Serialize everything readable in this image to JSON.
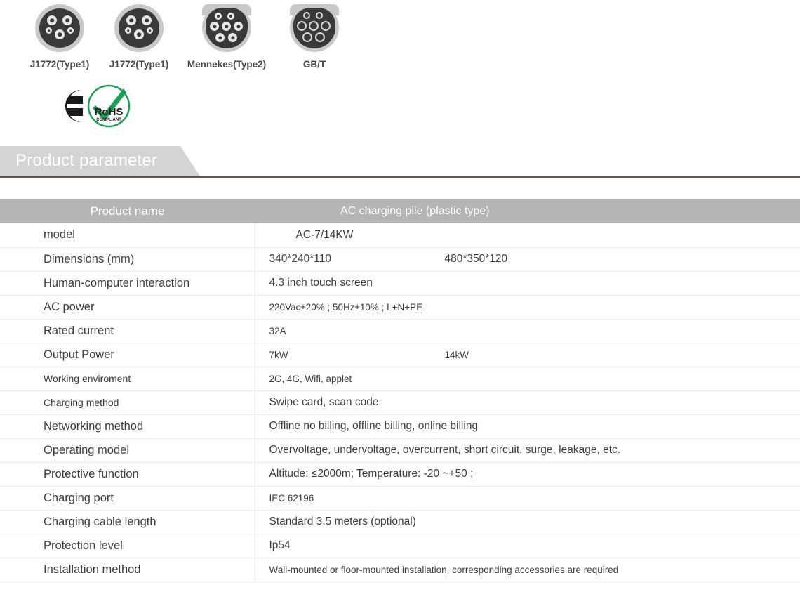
{
  "connectors": [
    {
      "label": "J1772(Type1)",
      "icon": "j1772-type1-connector-icon",
      "shape": "round"
    },
    {
      "label": "J1772(Type1)",
      "icon": "j1772-type1-connector-icon",
      "shape": "round"
    },
    {
      "label": "Mennekes(Type2)",
      "icon": "mennekes-type2-connector-icon",
      "shape": "flat"
    },
    {
      "label": "GB/T",
      "icon": "gbt-connector-icon",
      "shape": "flat"
    }
  ],
  "certifications": [
    {
      "name": "ce-mark-icon",
      "label": "CE"
    },
    {
      "name": "rohs-compliant-icon",
      "label": "RoHS",
      "sublabel": "COMPLIANT"
    }
  ],
  "section": {
    "title": "Product parameter",
    "banner_color": "#d5d3d3",
    "rule_color": "#6d4e4e"
  },
  "table": {
    "header": {
      "name": "Product name",
      "value": "AC charging pile (plastic type)",
      "background": "#b5b5b5",
      "text_color": "#ffffff"
    },
    "rows": [
      {
        "name": "model",
        "value": "AC-7/14KW",
        "name_size": "normal",
        "value_size": "normal",
        "indent": true
      },
      {
        "name": "Dimensions (mm)",
        "value": "340*240*110",
        "value2": "480*350*120",
        "name_size": "normal",
        "value_size": "normal"
      },
      {
        "name": "Human-computer interaction",
        "value": "4.3 inch touch screen",
        "name_size": "normal",
        "value_size": "normal"
      },
      {
        "name": "AC power",
        "value": "220Vac±20% ; 50Hz±10% ; L+N+PE",
        "name_size": "normal",
        "value_size": "small"
      },
      {
        "name": "Rated current",
        "value": "32A",
        "name_size": "normal",
        "value_size": "small"
      },
      {
        "name": "Output Power",
        "value": "7kW",
        "value2": "14kW",
        "name_size": "normal",
        "value_size": "small"
      },
      {
        "name": "Working enviroment",
        "value": "2G, 4G, Wifi, applet",
        "name_size": "small",
        "value_size": "small"
      },
      {
        "name": "Charging method",
        "value": "Swipe card, scan code",
        "name_size": "small",
        "value_size": "normal"
      },
      {
        "name": "Networking method",
        "value": "Offline no billing, offline billing, online billing",
        "name_size": "normal",
        "value_size": "normal"
      },
      {
        "name": "Operating model",
        "value": "Overvoltage, undervoltage, overcurrent, short circuit, surge, leakage, etc.",
        "name_size": "normal",
        "value_size": "normal"
      },
      {
        "name": "Protective function",
        "value": "Altitude: ≤2000m; Temperature: -20  ~+50  ;",
        "name_size": "normal",
        "value_size": "normal"
      },
      {
        "name": "Charging port",
        "value": "IEC  62196",
        "name_size": "normal",
        "value_size": "small"
      },
      {
        "name": "Charging cable length",
        "value": "Standard 3.5 meters (optional)",
        "name_size": "normal",
        "value_size": "normal"
      },
      {
        "name": "Protection level",
        "value": "Ip54",
        "name_size": "normal",
        "value_size": "normal"
      },
      {
        "name": "Installation method",
        "value": "Wall-mounted or floor-mounted installation, corresponding accessories are required",
        "name_size": "normal",
        "value_size": "small"
      }
    ]
  }
}
